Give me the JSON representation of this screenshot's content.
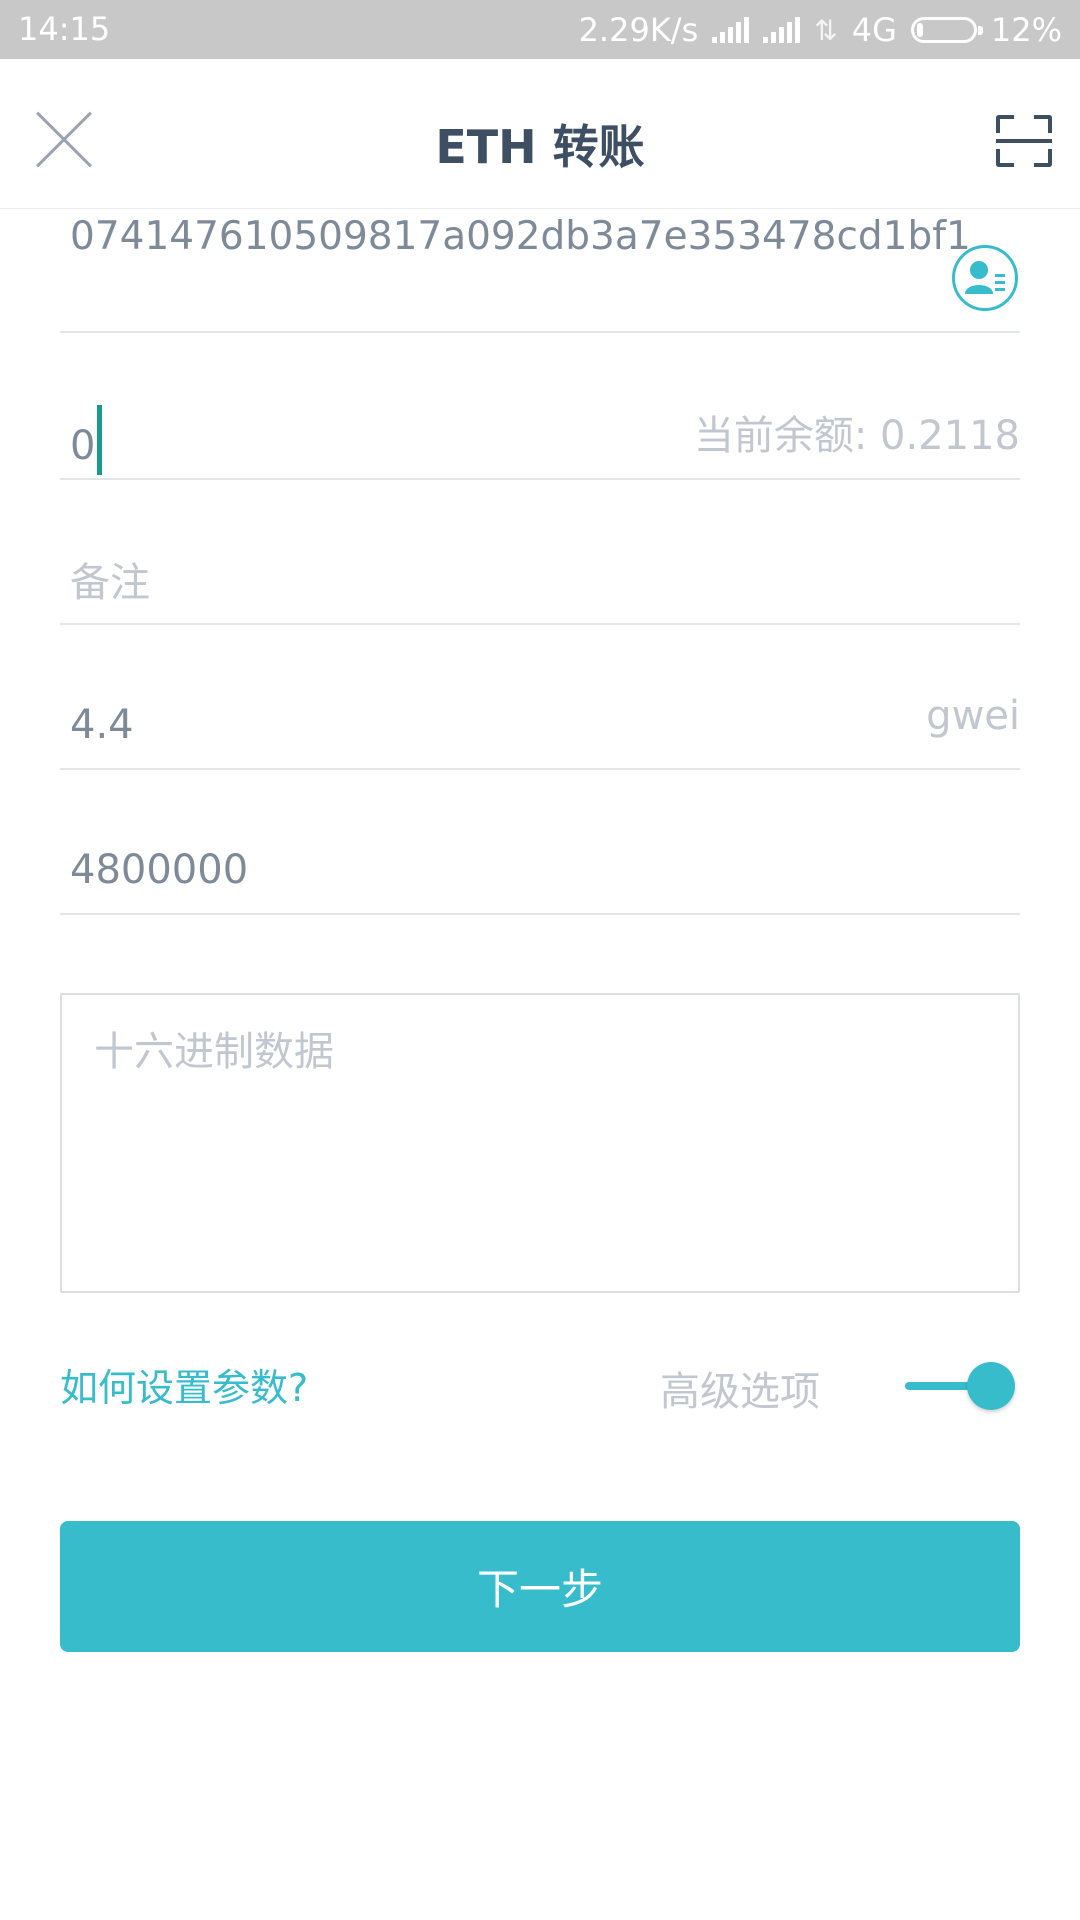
{
  "status_bar": {
    "time": "14:15",
    "net_speed": "2.29K/s",
    "network_type": "4G",
    "battery_percent": "12%",
    "battery_level": 0.12
  },
  "header": {
    "title": "ETH 转账",
    "close_icon": "close-icon",
    "scan_icon": "scan-icon"
  },
  "form": {
    "address": {
      "value": "074147610509817a092db3a7e353478cd1bf1",
      "contact_icon": "contact-book-icon"
    },
    "amount": {
      "value": "0",
      "balance_label": "当前余额: 0.2118"
    },
    "memo": {
      "placeholder": "备注"
    },
    "gas_price": {
      "value": "4.4",
      "unit": "gwei"
    },
    "gas_limit": {
      "value": "4800000"
    },
    "hex_data": {
      "placeholder": "十六进制数据"
    }
  },
  "options": {
    "help_link": "如何设置参数?",
    "advanced_label": "高级选项",
    "advanced_enabled": true
  },
  "next_button": {
    "label": "下一步"
  },
  "colors": {
    "accent": "#37bccb",
    "title": "#3f4f63",
    "placeholder": "#c2c7cf",
    "cursor": "#1a9a8e"
  }
}
